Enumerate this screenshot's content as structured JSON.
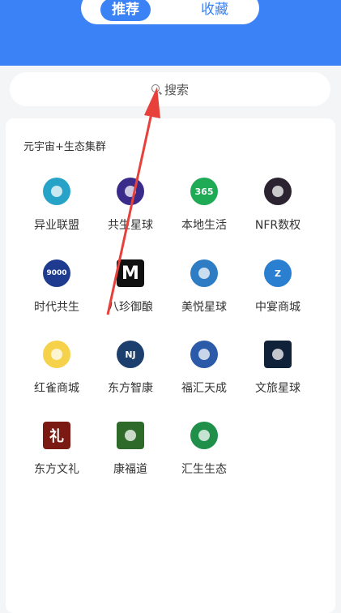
{
  "tabs": {
    "active": "推荐",
    "other": "收藏"
  },
  "search": {
    "placeholder": "搜索"
  },
  "section": {
    "title": "元宇宙+生态集群"
  },
  "apps": [
    {
      "label": "异业联盟",
      "icon": "swirl-logo-icon",
      "color": "#28a3c8"
    },
    {
      "label": "共生星球",
      "icon": "planet-logo-icon",
      "color": "#3a2a8a"
    },
    {
      "label": "本地生活",
      "icon": "365-logo-icon",
      "color": "#1faa55",
      "text": "365"
    },
    {
      "label": "NFR数权",
      "icon": "nfr-logo-icon",
      "color": "#2b2430"
    },
    {
      "label": "时代共生",
      "icon": "9000-logo-icon",
      "color": "#1e3b8f",
      "text": "9000"
    },
    {
      "label": "八珍御酿",
      "icon": "m-logo-icon",
      "color": "#111111",
      "text": "M"
    },
    {
      "label": "美悦星球",
      "icon": "bird-logo-icon",
      "color": "#2d7cc4"
    },
    {
      "label": "中宴商城",
      "icon": "z-logo-icon",
      "color": "#2a7fd0",
      "text": "Z"
    },
    {
      "label": "红雀商城",
      "icon": "redbird-logo-icon",
      "color": "#f5d24a"
    },
    {
      "label": "东方智康",
      "icon": "nj-logo-icon",
      "color": "#1d3f6e",
      "text": "NJ"
    },
    {
      "label": "福汇天成",
      "icon": "globe-logo-icon",
      "color": "#2a5aa8"
    },
    {
      "label": "文旅星球",
      "icon": "star-logo-icon",
      "color": "#10213a"
    },
    {
      "label": "东方文礼",
      "icon": "li-logo-icon",
      "color": "#7a1a12",
      "text": "礼"
    },
    {
      "label": "康福道",
      "icon": "emblem-logo-icon",
      "color": "#2e6b2a"
    },
    {
      "label": "汇生生态",
      "icon": "leaf-logo-icon",
      "color": "#1f8f4a"
    }
  ],
  "annotation": {
    "color": "#e8403a"
  }
}
